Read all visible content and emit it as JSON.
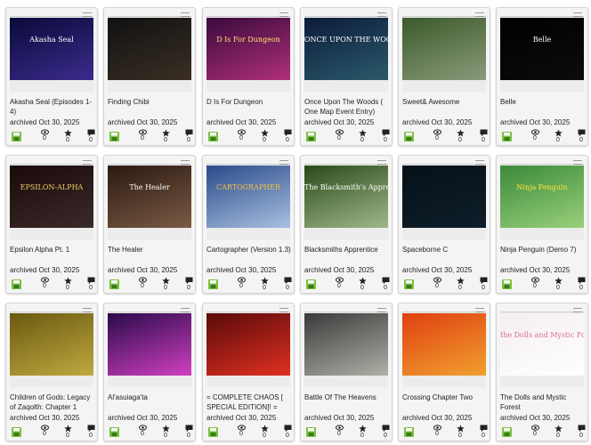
{
  "games": [
    {
      "title": "Akasha Seal (Episodes 1-4)",
      "status": "archived Oct 30, 2025",
      "views": "0",
      "stars": "0",
      "comments": "0",
      "shot_text": "Akasha Seal",
      "colors": {
        "bg1": "#0a0a3a",
        "bg2": "#3b2c8c",
        "text": "#ffffff"
      }
    },
    {
      "title": "Finding Chibi",
      "status": "archived Oct 30, 2025",
      "views": "0",
      "stars": "0",
      "comments": "0",
      "shot_text": "",
      "colors": {
        "bg1": "#111111",
        "bg2": "#3a2f24",
        "text": "#ffffff"
      }
    },
    {
      "title": "D Is For Dungeon",
      "status": "archived Oct 30, 2025",
      "views": "0",
      "stars": "0",
      "comments": "0",
      "shot_text": "D Is For Dungeon",
      "colors": {
        "bg1": "#3a0a3c",
        "bg2": "#b0307a",
        "text": "#ffe070"
      }
    },
    {
      "title": "Once Upon The Woods ( One Map Event Entry)",
      "status": "archived Oct 30, 2025",
      "views": "0",
      "stars": "0",
      "comments": "0",
      "shot_text": "ONCE UPON THE WOODS",
      "colors": {
        "bg1": "#0c1b3a",
        "bg2": "#2b5a6b",
        "text": "#ffffff"
      }
    },
    {
      "title": "Sweet& Awesome",
      "status": "archived Oct 30, 2025",
      "views": "0",
      "stars": "0",
      "comments": "0",
      "shot_text": "",
      "colors": {
        "bg1": "#3b5a2a",
        "bg2": "#8a9a7a",
        "text": "#ffffff"
      }
    },
    {
      "title": "Belle",
      "status": "archived Oct 30, 2025",
      "views": "0",
      "stars": "0",
      "comments": "0",
      "shot_text": "Belle",
      "colors": {
        "bg1": "#000000",
        "bg2": "#0c0c0c",
        "text": "#ffffff"
      }
    },
    {
      "title": "Epsilon Alpha Pt. 1",
      "status": "archived Oct 30, 2025",
      "views": "0",
      "stars": "0",
      "comments": "0",
      "shot_text": "EPSILON-ALPHA",
      "colors": {
        "bg1": "#1a0a0a",
        "bg2": "#3a2a2a",
        "text": "#f0d060"
      }
    },
    {
      "title": "The Healer",
      "status": "archived Oct 30, 2025",
      "views": "0",
      "stars": "0",
      "comments": "0",
      "shot_text": "The Healer",
      "colors": {
        "bg1": "#2b1a12",
        "bg2": "#7a5a44",
        "text": "#ffffff"
      }
    },
    {
      "title": "Cartographer (Version 1.3)",
      "status": "archived Oct 30, 2025",
      "views": "0",
      "stars": "0",
      "comments": "0",
      "shot_text": "CARTOGRAPHER",
      "colors": {
        "bg1": "#2a4a8a",
        "bg2": "#a8c0e0",
        "text": "#f0c040"
      }
    },
    {
      "title": "Blacksmiths Apprentice",
      "status": "archived Oct 30, 2025",
      "views": "0",
      "stars": "0",
      "comments": "0",
      "shot_text": "The Blacksmith's Apprentice",
      "colors": {
        "bg1": "#2a4a1a",
        "bg2": "#a0b88a",
        "text": "#ffffff"
      }
    },
    {
      "title": "Spaceborne C",
      "status": "archived Oct 30, 2025",
      "views": "0",
      "stars": "0",
      "comments": "0",
      "shot_text": "",
      "colors": {
        "bg1": "#061018",
        "bg2": "#0e1e2a",
        "text": "#9fd0ff"
      }
    },
    {
      "title": "Ninja Penguin (Demo 7)",
      "status": "archived Oct 30, 2025",
      "views": "0",
      "stars": "0",
      "comments": "0",
      "shot_text": "Ninja Penguin",
      "colors": {
        "bg1": "#3a8a3a",
        "bg2": "#9ad07a",
        "text": "#ffe040"
      }
    },
    {
      "title": "Children of Gods: Legacy of Zaqolth: Chapter 1",
      "status": "archived Oct 30, 2025",
      "views": "0",
      "stars": "0",
      "comments": "0",
      "shot_text": "",
      "colors": {
        "bg1": "#6a5a10",
        "bg2": "#c0a840",
        "text": "#ffffff"
      }
    },
    {
      "title": "Al'asuiaga'ta",
      "status": "archived Oct 30, 2025",
      "views": "0",
      "stars": "0",
      "comments": "0",
      "shot_text": "",
      "colors": {
        "bg1": "#2a0a4a",
        "bg2": "#d040c0",
        "text": "#ffffff"
      }
    },
    {
      "title": "= COMPLETE CHAOS [ SPECIAL EDITION]! =",
      "status": "archived Oct 30, 2025",
      "views": "0",
      "stars": "0",
      "comments": "0",
      "shot_text": "",
      "colors": {
        "bg1": "#5a0a0a",
        "bg2": "#e03020",
        "text": "#ffe040"
      }
    },
    {
      "title": "Battle Of The Heavens",
      "status": "archived Oct 30, 2025",
      "views": "0",
      "stars": "0",
      "comments": "0",
      "shot_text": "",
      "colors": {
        "bg1": "#3a3a3a",
        "bg2": "#b0b0a8",
        "text": "#ffffff"
      }
    },
    {
      "title": "Crossing Chapter Two",
      "status": "archived Oct 30, 2025",
      "views": "0",
      "stars": "0",
      "comments": "0",
      "shot_text": "",
      "colors": {
        "bg1": "#e04010",
        "bg2": "#f0a030",
        "text": "#ffffff"
      }
    },
    {
      "title": "The Dolls and Mystic Forest",
      "status": "archived Oct 30, 2025",
      "views": "0",
      "stars": "0",
      "comments": "0",
      "shot_text": "the Dolls and Mystic Forest",
      "colors": {
        "bg1": "#f4eef0",
        "bg2": "#ffffff",
        "text": "#d87090"
      }
    }
  ],
  "icons": {
    "save": "floppy-disk-icon",
    "views": "eye-icon",
    "stars": "star-icon",
    "comments": "comment-icon"
  },
  "accent": "#7ac142"
}
